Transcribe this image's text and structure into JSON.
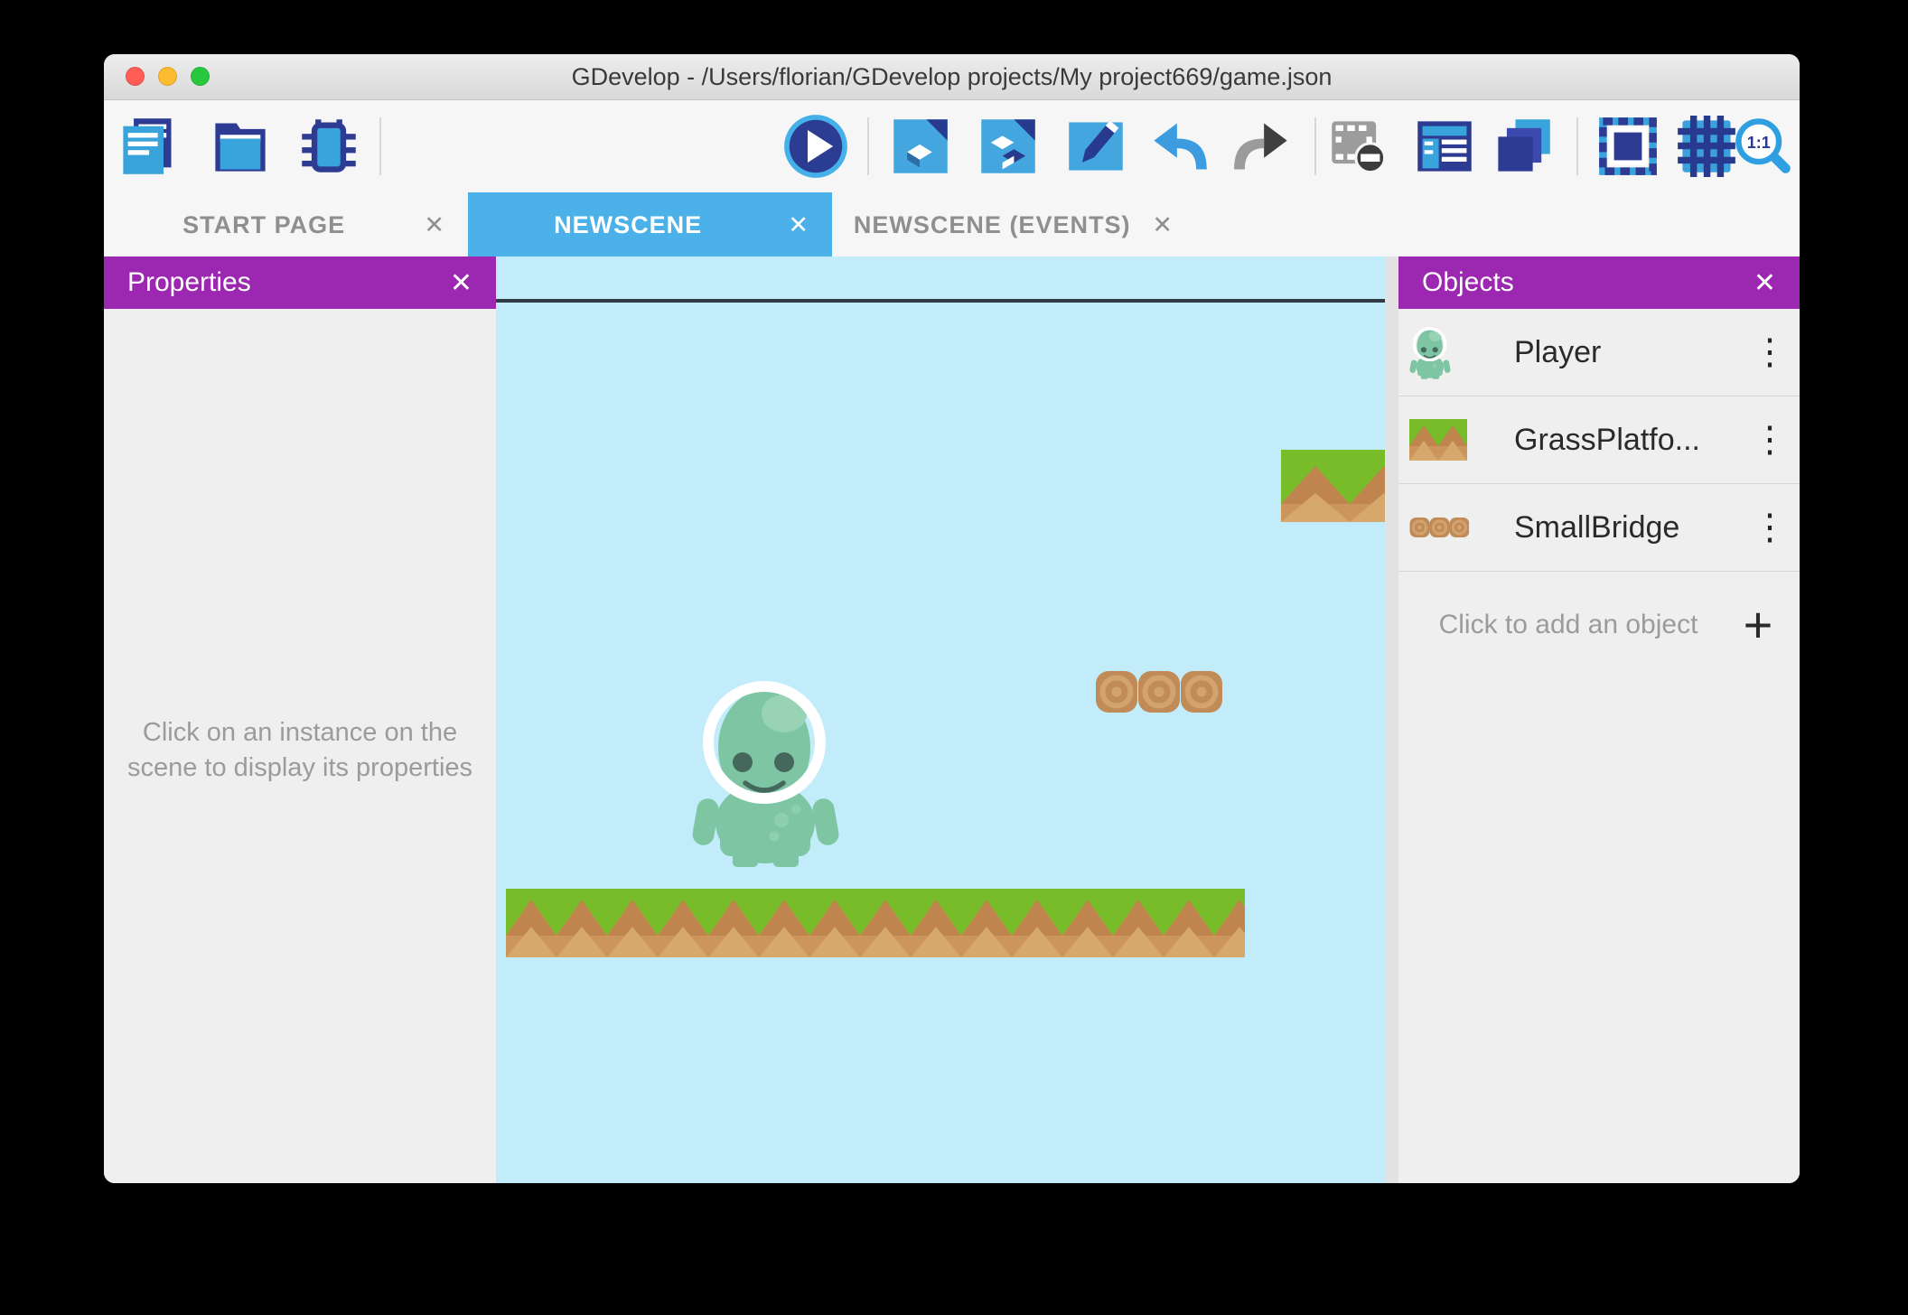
{
  "ui": {
    "close_glyph": "✕"
  },
  "title_bar": {
    "title": "GDevelop - /Users/florian/GDevelop projects/My project669/game.json"
  },
  "toolbar": {
    "zoom_label": "1:1",
    "buttons": [
      {
        "name": "new-project"
      },
      {
        "name": "open-project"
      },
      {
        "name": "debugger"
      },
      {
        "name": "play-preview"
      },
      {
        "name": "edit-scene"
      },
      {
        "name": "edit-objects"
      },
      {
        "name": "edit-scene-properties"
      },
      {
        "name": "undo"
      },
      {
        "name": "redo"
      },
      {
        "name": "toggle-mask"
      },
      {
        "name": "instances-list"
      },
      {
        "name": "layers"
      },
      {
        "name": "toggle-window-mask"
      },
      {
        "name": "toggle-grid"
      },
      {
        "name": "zoom-1-1"
      }
    ]
  },
  "tabs": {
    "items": [
      {
        "label": "START PAGE",
        "active": false
      },
      {
        "label": "NEWSCENE",
        "active": true
      },
      {
        "label": "NEWSCENE (EVENTS)",
        "active": false
      }
    ]
  },
  "properties_panel": {
    "title": "Properties",
    "empty_message": "Click on an instance on the scene to display its properties"
  },
  "objects_panel": {
    "title": "Objects",
    "menu_glyph": "⋮",
    "add_glyph": "+",
    "add_button_label": "Click to add an object",
    "objects": [
      {
        "name": "Player"
      },
      {
        "name": "GrassPlatfo..."
      },
      {
        "name": "SmallBridge"
      }
    ]
  },
  "scene": {
    "instances": [
      {
        "type": "Player"
      },
      {
        "type": "GrassPlatform",
        "note": "main ground platform"
      },
      {
        "type": "GrassPlatform",
        "note": "top-right platform, clipped by scene edge"
      },
      {
        "type": "SmallBridge"
      }
    ]
  },
  "colors": {
    "accent_purple": "#9c27b0",
    "active_tab_blue": "#4bb1e8",
    "scene_sky": "#c2ecfa",
    "grass_green": "#79bc2a",
    "dirt_brown": "#cb955c",
    "player_teal": "#7ec6a3",
    "toolbar_navy": "#2e3b92",
    "toolbar_blue": "#39a4dc"
  }
}
